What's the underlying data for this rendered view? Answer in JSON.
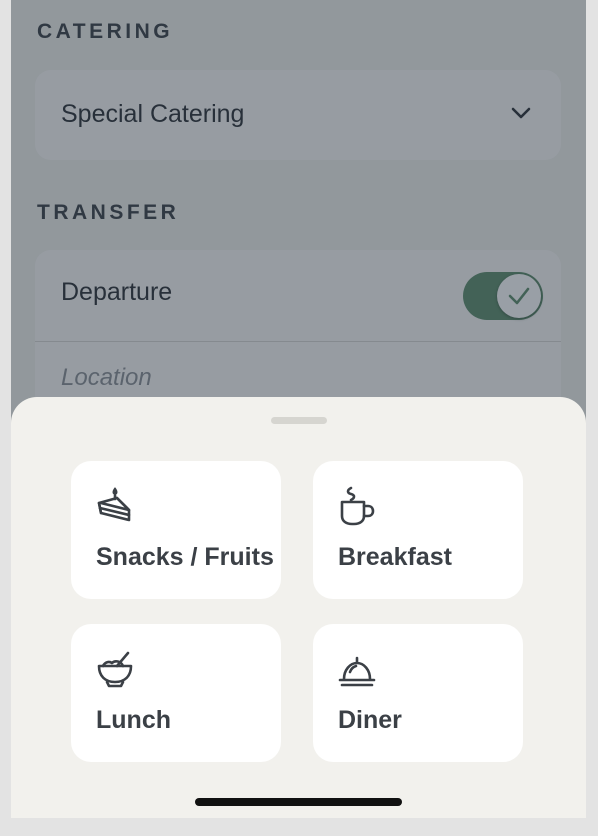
{
  "catering": {
    "section_title": "CATERING",
    "selected_value": "Special Catering"
  },
  "transfer": {
    "section_title": "TRANSFER",
    "departure_label": "Departure",
    "departure_enabled": true,
    "location_placeholder": "Location"
  },
  "sheet": {
    "options": [
      {
        "label": "Snacks / Fruits",
        "icon": "cake-slice-icon"
      },
      {
        "label": "Breakfast",
        "icon": "coffee-cup-icon"
      },
      {
        "label": "Lunch",
        "icon": "bowl-icon"
      },
      {
        "label": "Diner",
        "icon": "cloche-icon"
      }
    ]
  },
  "colors": {
    "toggle_on": "#5d8d6a",
    "sheet_background": "#f2f1ed",
    "tile_background": "#ffffff",
    "scrim": "#263242"
  }
}
